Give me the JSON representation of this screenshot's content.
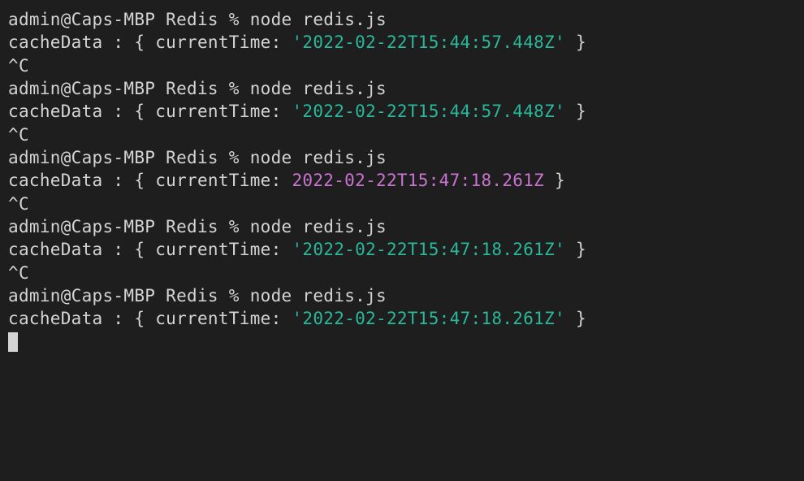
{
  "prompt": "admin@Caps-MBP Redis % ",
  "command": "node redis.js",
  "output_prefix": "cacheData : { currentTime: ",
  "output_suffix": " }",
  "interrupt": "^C",
  "timestamps": {
    "t1": "'2022-02-22T15:44:57.448Z'",
    "t2": "'2022-02-22T15:44:57.448Z'",
    "t3": "2022-02-22T15:47:18.261Z",
    "t4": "'2022-02-22T15:47:18.261Z'",
    "t5": "'2022-02-22T15:47:18.261Z'"
  }
}
